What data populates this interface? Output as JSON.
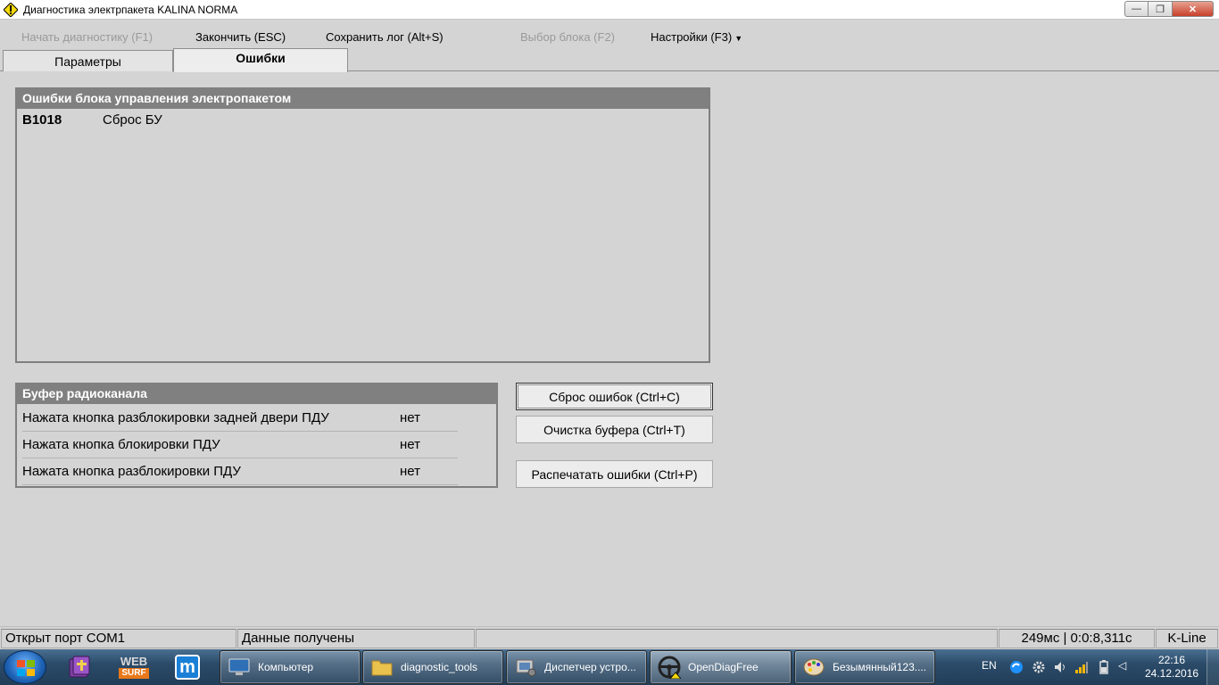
{
  "window": {
    "title": "Диагностика электрпакета KALINA NORMA",
    "minimize_label": "—",
    "maximize_label": "❐",
    "close_label": "✕"
  },
  "toolbar": {
    "start": "Начать диагностику (F1)",
    "finish": "Закончить (ESC)",
    "save_log": "Сохранить лог (Alt+S)",
    "select_block": "Выбор блока (F2)",
    "settings": "Настройки (F3)",
    "settings_caret": "▼"
  },
  "tabs": [
    {
      "label": "Параметры",
      "active": false
    },
    {
      "label": "Ошибки",
      "active": true
    }
  ],
  "errors_panel": {
    "title": "Ошибки блока управления электропакетом",
    "rows": [
      {
        "code": "B1018",
        "description": "Сброс БУ"
      }
    ]
  },
  "buffer_panel": {
    "title": "Буфер радиоканала",
    "rows": [
      {
        "label": "Нажата кнопка разблокировки задней двери ПДУ",
        "value": "нет"
      },
      {
        "label": "Нажата кнопка блокировки ПДУ",
        "value": "нет"
      },
      {
        "label": "Нажата кнопка разблокировки ПДУ",
        "value": "нет"
      }
    ]
  },
  "buttons": {
    "reset_errors": "Сброс ошибок (Ctrl+C)",
    "clear_buffer": "Очистка буфера (Ctrl+T)",
    "print_errors": "Распечатать ошибки (Ctrl+P)"
  },
  "statusbar": {
    "port": "Открыт порт COM1",
    "data": "Данные получены",
    "empty": "",
    "timing": "249мс | 0:0:8,311с",
    "protocol": "K-Line"
  },
  "taskbar": {
    "pinned": [
      {
        "icon": "bible-book-icon"
      },
      {
        "icon": "websurf-icon",
        "text_top": "WEB",
        "text_bottom": "SURF"
      },
      {
        "icon": "maxthon-icon",
        "letter": "m"
      }
    ],
    "tasks": [
      {
        "label": "Компьютер",
        "icon": "computer-icon"
      },
      {
        "label": "diagnostic_tools",
        "icon": "folder-icon"
      },
      {
        "label": "Диспетчер устро...",
        "icon": "device-manager-icon"
      },
      {
        "label": "OpenDiagFree",
        "icon": "steering-wheel-icon",
        "active": true
      },
      {
        "label": "Безымянный123....",
        "icon": "paint-palette-icon"
      }
    ],
    "tray": {
      "language": "EN",
      "time": "22:16",
      "date": "24.12.2016"
    }
  },
  "colors": {
    "panel_header": "#808080",
    "window_bg": "#d4d4d4",
    "close_button": "#c7402a",
    "taskbar": "#2b4b69"
  }
}
